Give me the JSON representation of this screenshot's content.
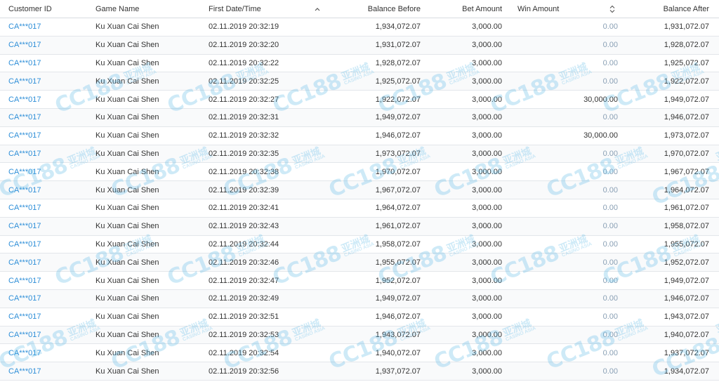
{
  "columns": {
    "customer_id": "Customer ID",
    "game_name": "Game Name",
    "first_date_time": "First Date/Time",
    "balance_before": "Balance Before",
    "bet_amount": "Bet Amount",
    "win_amount": "Win Amount",
    "balance_after": "Balance After"
  },
  "sort": {
    "active_column": "first_date_time",
    "direction": "ascending",
    "icon": "chevron-up-icon",
    "win_amount_icon": "sort-updown-icon"
  },
  "colors": {
    "link": "#2f8fd8",
    "muted": "#8aa0b5",
    "watermark": "#52b6e6"
  },
  "watermark": {
    "logo_text": "CC188",
    "chinese": "亚洲城",
    "english": "CASINO ASIA"
  },
  "rows": [
    {
      "customer_id": "CA***017",
      "game_name": "Ku Xuan Cai Shen",
      "first_date_time": "02.11.2019 20:32:19",
      "balance_before": "1,934,072.07",
      "bet_amount": "3,000.00",
      "win_amount": "0.00",
      "balance_after": "1,931,072.07"
    },
    {
      "customer_id": "CA***017",
      "game_name": "Ku Xuan Cai Shen",
      "first_date_time": "02.11.2019 20:32:20",
      "balance_before": "1,931,072.07",
      "bet_amount": "3,000.00",
      "win_amount": "0.00",
      "balance_after": "1,928,072.07"
    },
    {
      "customer_id": "CA***017",
      "game_name": "Ku Xuan Cai Shen",
      "first_date_time": "02.11.2019 20:32:22",
      "balance_before": "1,928,072.07",
      "bet_amount": "3,000.00",
      "win_amount": "0.00",
      "balance_after": "1,925,072.07"
    },
    {
      "customer_id": "CA***017",
      "game_name": "Ku Xuan Cai Shen",
      "first_date_time": "02.11.2019 20:32:25",
      "balance_before": "1,925,072.07",
      "bet_amount": "3,000.00",
      "win_amount": "0.00",
      "balance_after": "1,922,072.07"
    },
    {
      "customer_id": "CA***017",
      "game_name": "Ku Xuan Cai Shen",
      "first_date_time": "02.11.2019 20:32:27",
      "balance_before": "1,922,072.07",
      "bet_amount": "3,000.00",
      "win_amount": "30,000.00",
      "balance_after": "1,949,072.07"
    },
    {
      "customer_id": "CA***017",
      "game_name": "Ku Xuan Cai Shen",
      "first_date_time": "02.11.2019 20:32:31",
      "balance_before": "1,949,072.07",
      "bet_amount": "3,000.00",
      "win_amount": "0.00",
      "balance_after": "1,946,072.07"
    },
    {
      "customer_id": "CA***017",
      "game_name": "Ku Xuan Cai Shen",
      "first_date_time": "02.11.2019 20:32:32",
      "balance_before": "1,946,072.07",
      "bet_amount": "3,000.00",
      "win_amount": "30,000.00",
      "balance_after": "1,973,072.07"
    },
    {
      "customer_id": "CA***017",
      "game_name": "Ku Xuan Cai Shen",
      "first_date_time": "02.11.2019 20:32:35",
      "balance_before": "1,973,072.07",
      "bet_amount": "3,000.00",
      "win_amount": "0.00",
      "balance_after": "1,970,072.07"
    },
    {
      "customer_id": "CA***017",
      "game_name": "Ku Xuan Cai Shen",
      "first_date_time": "02.11.2019 20:32:38",
      "balance_before": "1,970,072.07",
      "bet_amount": "3,000.00",
      "win_amount": "0.00",
      "balance_after": "1,967,072.07"
    },
    {
      "customer_id": "CA***017",
      "game_name": "Ku Xuan Cai Shen",
      "first_date_time": "02.11.2019 20:32:39",
      "balance_before": "1,967,072.07",
      "bet_amount": "3,000.00",
      "win_amount": "0.00",
      "balance_after": "1,964,072.07"
    },
    {
      "customer_id": "CA***017",
      "game_name": "Ku Xuan Cai Shen",
      "first_date_time": "02.11.2019 20:32:41",
      "balance_before": "1,964,072.07",
      "bet_amount": "3,000.00",
      "win_amount": "0.00",
      "balance_after": "1,961,072.07"
    },
    {
      "customer_id": "CA***017",
      "game_name": "Ku Xuan Cai Shen",
      "first_date_time": "02.11.2019 20:32:43",
      "balance_before": "1,961,072.07",
      "bet_amount": "3,000.00",
      "win_amount": "0.00",
      "balance_after": "1,958,072.07"
    },
    {
      "customer_id": "CA***017",
      "game_name": "Ku Xuan Cai Shen",
      "first_date_time": "02.11.2019 20:32:44",
      "balance_before": "1,958,072.07",
      "bet_amount": "3,000.00",
      "win_amount": "0.00",
      "balance_after": "1,955,072.07"
    },
    {
      "customer_id": "CA***017",
      "game_name": "Ku Xuan Cai Shen",
      "first_date_time": "02.11.2019 20:32:46",
      "balance_before": "1,955,072.07",
      "bet_amount": "3,000.00",
      "win_amount": "0.00",
      "balance_after": "1,952,072.07"
    },
    {
      "customer_id": "CA***017",
      "game_name": "Ku Xuan Cai Shen",
      "first_date_time": "02.11.2019 20:32:47",
      "balance_before": "1,952,072.07",
      "bet_amount": "3,000.00",
      "win_amount": "0.00",
      "balance_after": "1,949,072.07"
    },
    {
      "customer_id": "CA***017",
      "game_name": "Ku Xuan Cai Shen",
      "first_date_time": "02.11.2019 20:32:49",
      "balance_before": "1,949,072.07",
      "bet_amount": "3,000.00",
      "win_amount": "0.00",
      "balance_after": "1,946,072.07"
    },
    {
      "customer_id": "CA***017",
      "game_name": "Ku Xuan Cai Shen",
      "first_date_time": "02.11.2019 20:32:51",
      "balance_before": "1,946,072.07",
      "bet_amount": "3,000.00",
      "win_amount": "0.00",
      "balance_after": "1,943,072.07"
    },
    {
      "customer_id": "CA***017",
      "game_name": "Ku Xuan Cai Shen",
      "first_date_time": "02.11.2019 20:32:53",
      "balance_before": "1,943,072.07",
      "bet_amount": "3,000.00",
      "win_amount": "0.00",
      "balance_after": "1,940,072.07"
    },
    {
      "customer_id": "CA***017",
      "game_name": "Ku Xuan Cai Shen",
      "first_date_time": "02.11.2019 20:32:54",
      "balance_before": "1,940,072.07",
      "bet_amount": "3,000.00",
      "win_amount": "0.00",
      "balance_after": "1,937,072.07"
    },
    {
      "customer_id": "CA***017",
      "game_name": "Ku Xuan Cai Shen",
      "first_date_time": "02.11.2019 20:32:56",
      "balance_before": "1,937,072.07",
      "bet_amount": "3,000.00",
      "win_amount": "0.00",
      "balance_after": "1,934,072.07"
    }
  ]
}
